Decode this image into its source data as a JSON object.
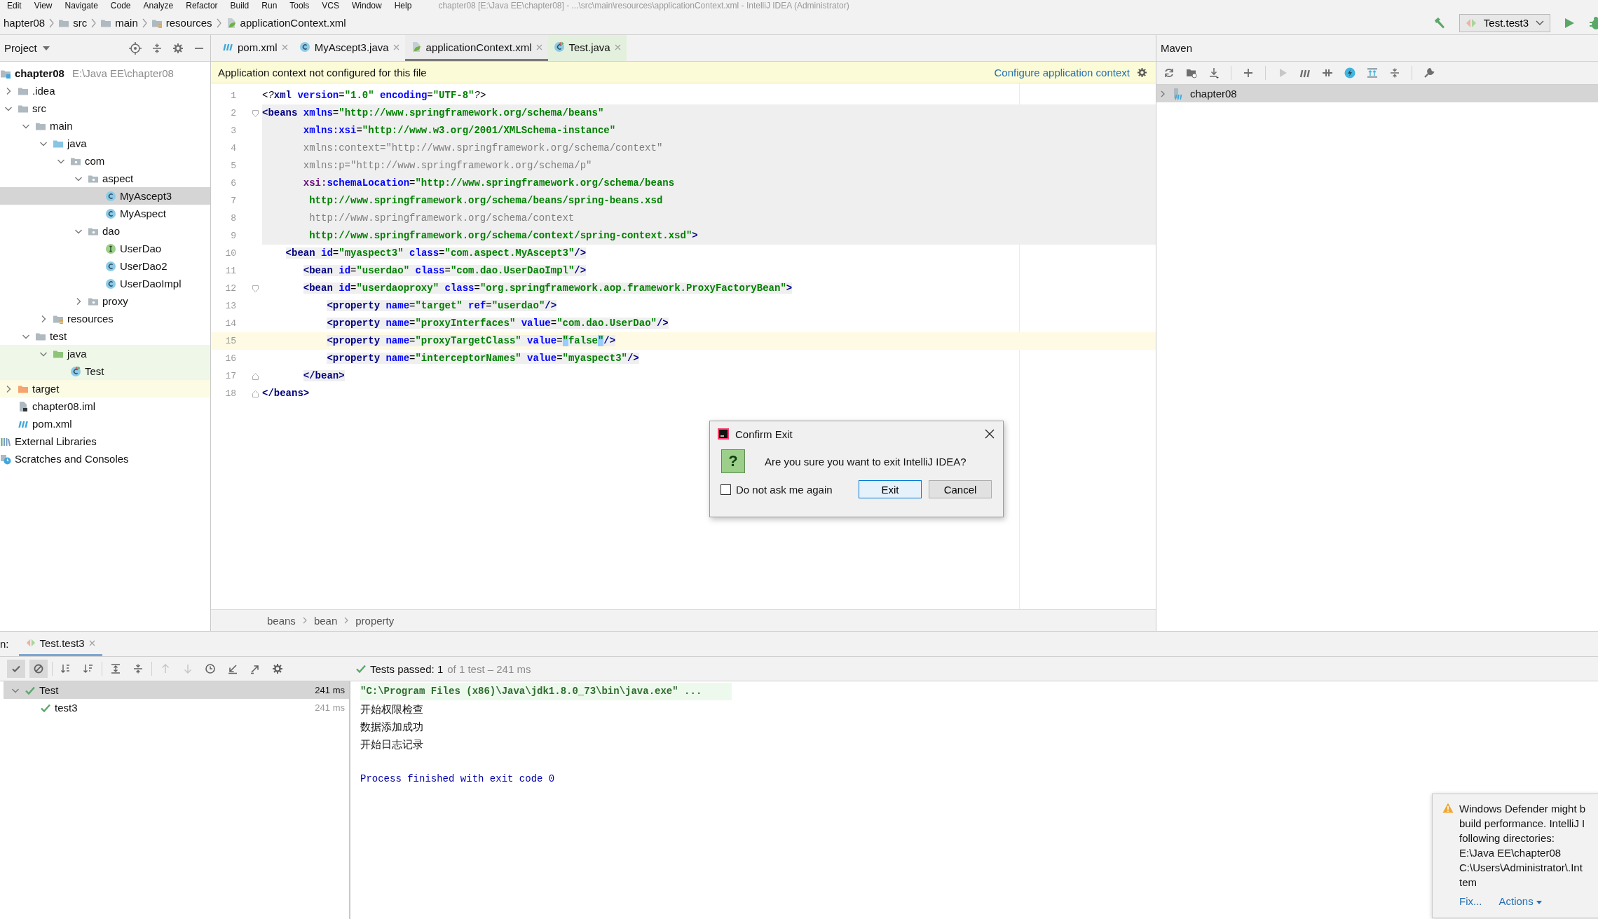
{
  "menu_bar": {
    "items": [
      "Edit",
      "View",
      "Navigate",
      "Code",
      "Analyze",
      "Refactor",
      "Build",
      "Run",
      "Tools",
      "VCS",
      "Window",
      "Help"
    ],
    "title": "chapter08 [E:\\Java EE\\chapter08] - ...\\src\\main\\resources\\applicationContext.xml - IntelliJ IDEA (Administrator)"
  },
  "nav_bar": {
    "crumbs": [
      {
        "label": "hapter08",
        "kind": "text"
      },
      {
        "label": "src",
        "kind": "folder"
      },
      {
        "label": "main",
        "kind": "folder"
      },
      {
        "label": "resources",
        "kind": "resources"
      },
      {
        "label": "applicationContext.xml",
        "kind": "xml"
      }
    ],
    "run_config": "Test.test3"
  },
  "project": {
    "title": "Project",
    "tree": [
      {
        "label": "chapter08",
        "kind": "module",
        "path": "E:\\Java EE\\chapter08",
        "children": [
          {
            "label": ".idea",
            "kind": "folder",
            "expanded": false
          },
          {
            "label": "src",
            "kind": "folder",
            "expanded": true,
            "children": [
              {
                "label": "main",
                "kind": "folder",
                "expanded": true,
                "children": [
                  {
                    "label": "java",
                    "kind": "source",
                    "expanded": true,
                    "children": [
                      {
                        "label": "com",
                        "kind": "package",
                        "expanded": true,
                        "children": [
                          {
                            "label": "aspect",
                            "kind": "package",
                            "expanded": true,
                            "children": [
                              {
                                "label": "MyAscept3",
                                "kind": "class",
                                "selected": true
                              },
                              {
                                "label": "MyAspect",
                                "kind": "class",
                                "selected": false
                              }
                            ]
                          },
                          {
                            "label": "dao",
                            "kind": "package",
                            "expanded": true,
                            "children": [
                              {
                                "label": "UserDao",
                                "kind": "interface",
                                "selected": false
                              },
                              {
                                "label": "UserDao2",
                                "kind": "class",
                                "selected": false
                              },
                              {
                                "label": "UserDaoImpl",
                                "kind": "class",
                                "selected": false
                              }
                            ]
                          },
                          {
                            "label": "proxy",
                            "kind": "package",
                            "expanded": false
                          }
                        ]
                      }
                    ]
                  },
                  {
                    "label": "resources",
                    "kind": "resources",
                    "expanded": false
                  }
                ]
              },
              {
                "label": "test",
                "kind": "folder",
                "expanded": true,
                "children": [
                  {
                    "label": "java",
                    "kind": "test",
                    "expanded": true,
                    "test_source": true,
                    "children": [
                      {
                        "label": "Test",
                        "kind": "test-class",
                        "test_source": true,
                        "selected": false
                      }
                    ]
                  }
                ]
              }
            ]
          },
          {
            "label": "target",
            "kind": "excluded",
            "expanded": false,
            "excluded": true
          },
          {
            "label": "chapter08.iml",
            "kind": "iml",
            "selected": false
          },
          {
            "label": "pom.xml",
            "kind": "maven",
            "selected": false
          }
        ]
      },
      {
        "label": "External Libraries",
        "kind": "libraries"
      },
      {
        "label": "Scratches and Consoles",
        "kind": "scratches"
      }
    ]
  },
  "editor": {
    "tabs": [
      {
        "label": "pom.xml",
        "kind": "maven",
        "selected": false
      },
      {
        "label": "MyAscept3.java",
        "kind": "class",
        "selected": false
      },
      {
        "label": "applicationContext.xml",
        "kind": "xml",
        "selected": true
      },
      {
        "label": "Test.java",
        "kind": "test-class",
        "selected": false
      }
    ],
    "banner": {
      "message": "Application context not configured for this file",
      "action": "Configure application context"
    },
    "lines": [
      {
        "number": "1",
        "tokens": [
          {
            "text": "<?",
            "kind": "pi"
          },
          {
            "text": "xml",
            "kind": "tag"
          },
          {
            "text": " version",
            "kind": "attr"
          },
          {
            "text": "=",
            "kind": "plain"
          },
          {
            "text": "\"1.0\"",
            "kind": "value"
          },
          {
            "text": " encoding",
            "kind": "attr"
          },
          {
            "text": "=",
            "kind": "plain"
          },
          {
            "text": "\"UTF-8\"",
            "kind": "value"
          },
          {
            "text": "?>",
            "kind": "pi"
          }
        ]
      },
      {
        "number": "2",
        "fold_start": true,
        "shaded": true,
        "tokens": [
          {
            "text": "<beans",
            "kind": "tag"
          },
          {
            "text": " xmlns",
            "kind": "attr"
          },
          {
            "text": "=",
            "kind": "plain"
          },
          {
            "text": "\"http://www.springframework.org/schema/beans\"",
            "kind": "value"
          }
        ]
      },
      {
        "number": "3",
        "shaded": true,
        "tokens": [
          {
            "text": "       xmlns:xsi",
            "kind": "attr"
          },
          {
            "text": "=",
            "kind": "plain"
          },
          {
            "text": "\"http://www.w3.org/2001/XMLSchema-instance\"",
            "kind": "value"
          }
        ]
      },
      {
        "number": "4",
        "shaded": true,
        "tokens": [
          {
            "text": "       xmlns:context=\"http://www.springframework.org/schema/context\"",
            "kind": "unused"
          }
        ]
      },
      {
        "number": "5",
        "shaded": true,
        "tokens": [
          {
            "text": "       xmlns:p=\"http://www.springframework.org/schema/p\"",
            "kind": "unused"
          }
        ]
      },
      {
        "number": "6",
        "shaded": true,
        "tokens": [
          {
            "text": "       xsi:",
            "kind": "ns"
          },
          {
            "text": "schemaLocation",
            "kind": "attr"
          },
          {
            "text": "=",
            "kind": "plain"
          },
          {
            "text": "\"http://www.springframework.org/schema/beans",
            "kind": "value"
          }
        ]
      },
      {
        "number": "7",
        "shaded": true,
        "tokens": [
          {
            "text": "        http://www.springframework.org/schema/beans/spring-beans.xsd",
            "kind": "value"
          }
        ]
      },
      {
        "number": "8",
        "shaded": true,
        "tokens": [
          {
            "text": "        http://www.springframework.org/schema/context",
            "kind": "unused"
          }
        ]
      },
      {
        "number": "9",
        "shaded": true,
        "tokens": [
          {
            "text": "        http://www.springframework.org/schema/context/spring-context.xsd\"",
            "kind": "value"
          },
          {
            "text": ">",
            "kind": "tag"
          }
        ]
      },
      {
        "number": "10",
        "tag_shaded": true,
        "tokens": [
          {
            "text": "    <bean",
            "kind": "tag"
          },
          {
            "text": " id",
            "kind": "attr"
          },
          {
            "text": "=",
            "kind": "plain"
          },
          {
            "text": "\"myaspect3\"",
            "kind": "value"
          },
          {
            "text": " class",
            "kind": "attr"
          },
          {
            "text": "=",
            "kind": "plain"
          },
          {
            "text": "\"com.aspect.MyAscept3\"",
            "kind": "value"
          },
          {
            "text": "/>",
            "kind": "tag"
          }
        ]
      },
      {
        "number": "11",
        "tag_shaded": true,
        "tokens": [
          {
            "text": "       <bean",
            "kind": "tag"
          },
          {
            "text": " id",
            "kind": "attr"
          },
          {
            "text": "=",
            "kind": "plain"
          },
          {
            "text": "\"userdao\"",
            "kind": "value"
          },
          {
            "text": " class",
            "kind": "attr"
          },
          {
            "text": "=",
            "kind": "plain"
          },
          {
            "text": "\"com.dao.UserDaoImpl\"",
            "kind": "value"
          },
          {
            "text": "/>",
            "kind": "tag"
          }
        ]
      },
      {
        "number": "12",
        "fold_start": true,
        "tag_shaded": true,
        "tokens": [
          {
            "text": "       <bean",
            "kind": "tag"
          },
          {
            "text": " id",
            "kind": "attr"
          },
          {
            "text": "=",
            "kind": "plain"
          },
          {
            "text": "\"userdaoproxy\"",
            "kind": "value"
          },
          {
            "text": " class",
            "kind": "attr"
          },
          {
            "text": "=",
            "kind": "plain"
          },
          {
            "text": "\"org.springframework.aop.framework.ProxyFactoryBean\"",
            "kind": "value"
          },
          {
            "text": ">",
            "kind": "tag"
          }
        ]
      },
      {
        "number": "13",
        "tag_shaded": true,
        "tokens": [
          {
            "text": "           <property",
            "kind": "tag"
          },
          {
            "text": " name",
            "kind": "attr"
          },
          {
            "text": "=",
            "kind": "plain"
          },
          {
            "text": "\"target\"",
            "kind": "value"
          },
          {
            "text": " ref",
            "kind": "attr"
          },
          {
            "text": "=",
            "kind": "plain"
          },
          {
            "text": "\"userdao\"",
            "kind": "value"
          },
          {
            "text": "/>",
            "kind": "tag"
          }
        ]
      },
      {
        "number": "14",
        "tag_shaded": true,
        "tokens": [
          {
            "text": "           <property",
            "kind": "tag"
          },
          {
            "text": " name",
            "kind": "attr"
          },
          {
            "text": "=",
            "kind": "plain"
          },
          {
            "text": "\"proxyInterfaces\"",
            "kind": "value"
          },
          {
            "text": " value",
            "kind": "attr"
          },
          {
            "text": "=",
            "kind": "plain"
          },
          {
            "text": "\"com.dao.UserDao\"",
            "kind": "value"
          },
          {
            "text": "/>",
            "kind": "tag"
          }
        ]
      },
      {
        "number": "15",
        "current": true,
        "tag_shaded": true,
        "tokens": [
          {
            "text": "           <property",
            "kind": "tag"
          },
          {
            "text": " name",
            "kind": "attr"
          },
          {
            "text": "=",
            "kind": "plain"
          },
          {
            "text": "\"proxyTargetClass\"",
            "kind": "value"
          },
          {
            "text": " value",
            "kind": "attr"
          },
          {
            "text": "=",
            "kind": "plain"
          },
          {
            "text": "\"",
            "kind": "match"
          },
          {
            "text": "false",
            "kind": "value"
          },
          {
            "text": "\"",
            "kind": "match"
          },
          {
            "text": "/>",
            "kind": "tag"
          }
        ]
      },
      {
        "number": "16",
        "tag_shaded": true,
        "tokens": [
          {
            "text": "           <property",
            "kind": "tag"
          },
          {
            "text": " name",
            "kind": "attr"
          },
          {
            "text": "=",
            "kind": "plain"
          },
          {
            "text": "\"interceptorNames\"",
            "kind": "value"
          },
          {
            "text": " value",
            "kind": "attr"
          },
          {
            "text": "=",
            "kind": "plain"
          },
          {
            "text": "\"myaspect3\"",
            "kind": "value"
          },
          {
            "text": "/>",
            "kind": "tag"
          }
        ]
      },
      {
        "number": "17",
        "fold_end": true,
        "tag_shaded": true,
        "tokens": [
          {
            "text": "       </bean>",
            "kind": "tag"
          }
        ]
      },
      {
        "number": "18",
        "fold_end": true,
        "tokens": [
          {
            "text": "</beans>",
            "kind": "tag"
          }
        ]
      }
    ],
    "breadcrumbs": [
      "beans",
      "bean",
      "property"
    ]
  },
  "maven": {
    "title": "Maven",
    "tree": [
      {
        "label": "chapter08",
        "expanded": false,
        "selected": true
      }
    ]
  },
  "run": {
    "label": "n:",
    "tabs": [
      {
        "label": "Test.test3",
        "selected": true
      }
    ],
    "toolbar": [
      {
        "kind": "show-passed",
        "on": true,
        "disabled": false
      },
      {
        "kind": "show-ignored",
        "on": true,
        "disabled": false
      },
      {
        "kind": "sort-alpha",
        "on": false,
        "disabled": false
      },
      {
        "kind": "sort-duration",
        "on": false,
        "disabled": false
      },
      {
        "kind": "expand-all",
        "on": false,
        "disabled": false
      },
      {
        "kind": "collapse-all",
        "on": false,
        "disabled": false
      },
      {
        "kind": "previous",
        "on": false,
        "disabled": true
      },
      {
        "kind": "next",
        "on": false,
        "disabled": true
      },
      {
        "kind": "history",
        "on": false,
        "disabled": false
      },
      {
        "kind": "import",
        "on": false,
        "disabled": false
      },
      {
        "kind": "export",
        "on": false,
        "disabled": false
      },
      {
        "kind": "settings",
        "on": false,
        "disabled": false
      }
    ],
    "status": {
      "summary": "Tests passed: 1",
      "detail": "of 1 test – 241 ms"
    },
    "tests": [
      {
        "name": "Test",
        "time": "241 ms",
        "selected": true,
        "expanded": true,
        "children": [
          {
            "name": "test3",
            "time": "241 ms",
            "selected": false
          }
        ]
      }
    ],
    "console": [
      {
        "text": "\"C:\\Program Files (x86)\\Java\\jdk1.8.0_73\\bin\\java.exe\" ...",
        "kind": "command"
      },
      {
        "text": "开始权限检查",
        "kind": "output"
      },
      {
        "text": "数据添加成功",
        "kind": "output"
      },
      {
        "text": "开始日志记录",
        "kind": "output"
      },
      {
        "text": "Process finished with exit code 0",
        "kind": "exit"
      }
    ]
  },
  "dialog": {
    "title": "Confirm Exit",
    "icon": "?",
    "message": "Are you sure you want to exit IntelliJ IDEA?",
    "checkbox": {
      "label": "Do not ask me again",
      "checked": false
    },
    "buttons": [
      {
        "label": "Exit",
        "default": true
      },
      {
        "label": "Cancel",
        "default": false
      }
    ]
  },
  "notification": {
    "lines": [
      "Windows Defender might b",
      "build performance. IntelliJ I",
      "following directories:",
      "E:\\Java EE\\chapter08",
      "C:\\Users\\Administrator\\.Int",
      "tem"
    ],
    "actions": [
      {
        "label": "Fix...",
        "kind": "link"
      },
      {
        "label": "Actions",
        "kind": "menu"
      }
    ]
  }
}
